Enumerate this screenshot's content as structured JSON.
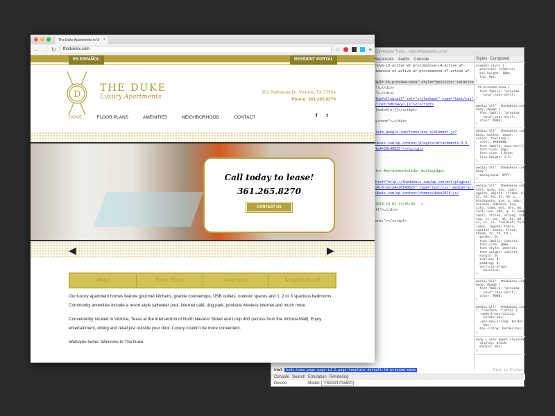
{
  "devtools": {
    "title": "Developer Tools - http://thedukeix.com/",
    "tabs": [
      "Resources",
      "Audits",
      "Console"
    ],
    "code_lines": [
      {
        "text": "nova-i3-active wf-proximanova-i4-active wf-",
        "cls": ""
      },
      {
        "text": "imanova-n4-active wf-proximanova-n7-active wf-",
        "cls": ""
      },
      {
        "text": "",
        "cls": ""
      },
      {
        "text": "ault tk-proxima-nova\" style=\"position: relative;",
        "cls": "sel"
      },
      {
        "text": "\">…</div>",
        "cls": ""
      },
      {
        "text": "\">…</div>",
        "cls": ""
      },
      {
        "text": "lowfollowtail\" rel=\"stylesheet\" type=\"text/css\">",
        "cls": "lnk"
      },
      {
        "text": "c.net/bdb2wwyu.js\"></script>",
        "cls": "lnk"
      },
      {
        "text": "}catch(e){}</script>",
        "cls": ""
      },
      {
        "text": "",
        "cls": ""
      },
      {
        "text": "y:none\">…</div>",
        "cls": ""
      },
      {
        "text": "",
        "cls": ""
      },
      {
        "text": "late.google.com/translate_a/element.js?",
        "cls": "lnk"
      },
      {
        "text": "",
        "cls": ""
      },
      {
        "text": "ukeix.com/wp-content/plugins/attachments-3.5.",
        "cls": "lnk"
      },
      {
        "text": "ta4=20140825\"></script>",
        "cls": "lnk"
      },
      {
        "text": "",
        "cls": ""
      },
      {
        "text": "",
        "cls": ""
      },
      {
        "text": "",
        "cls": ""
      },
      {
        "text": "for #attachmentslider_multiwidget",
        "cls": "cm"
      },
      {
        "text": "",
        "cls": ""
      },
      {
        "text": "href=\"http://thedukeix.com/wp-content/plugins/",
        "cls": "lnk"
      },
      {
        "text": "s4-8-beta4=20140825\" type=\"text/css\" media=\"all\">",
        "cls": "lnk"
      },
      {
        "text": "ukeix.com/wp-content/themes/duke2014/js/",
        "cls": "lnk"
      },
      {
        "text": "",
        "cls": ""
      },
      {
        "text": "2014-10-01 13:45:09 -->",
        "cls": "cm"
      },
      {
        "text": "ft\">…</div>",
        "cls": ""
      },
      {
        "text": "",
        "cls": ""
      },
      {
        "text": "one;\"></script>",
        "cls": ""
      }
    ],
    "styles_tabs": [
      "Styles",
      "Computed"
    ],
    "style_rules": [
      "element.style {\n  position: relative;\n  min-height: 100%;\n  top: 0px;\n}",
      ".tk-proxima-nova {\n  font-family: \"proxima-\n    nova\",sans-serif;\n}",
      "media=\"all\"  thedukeix.com/\nbody, #page {\n  font-family: \"proxima-\n    nova\",sans-serif;\n  color: #000;\n}",
      "media=\"all\"  thedukeix.com/\nbody, button, input,\nselect, textarea {\n  color: #404040;\n  font-family: sans-serif;\n  font-size: 16px;\n  font-size: 1.6rem;\n  line-height: 1.5;\n}",
      "media=\"all\"  thedukeix.com/\nbody {\n  background: #fff;\n}",
      "media=\"all\"  thedukeix.com/\nhtml, body, div, span,\napplet, object, iframe, h1,\nh2, h3, h4, h5, h6, p,\nblockquote, pre, a, abbr,\nacronym, address, big,\ncite, code, del, dfn, em,\nfont, ins, kbd, q, s, samp,\nsmall, strike, strong, sub,\nsup, tt, var, dl, dt, dd,\nol, ul, li, fieldset, form,\nlabel, legend, table,\ncaption, tbody, tfoot,\nthead, tr, th, td {\n  border: 0;\n  font-family: inherit;\n  font-size: 100%;\n  font-style: inherit;\n  font-weight: inherit;\n  margin: 0;\n  outline: 0;\n  padding: 0;\n  vertical-align:\n    baseline;\n}",
      "media=\"all\"  thedukeix.com/\nbody, #page {\n  font-family: \"proxima-\n    nova\",sans-serif;\n  color: #000;\n}",
      "media=\"all\"  thedukeix.com/\n*, *:before, *:after {\n  -webkit-box-sizing:\n    border-box;\n  -moz-box-sizing: border-\n    box;\n  box-sizing: border-box;\n}",
      "body { user agent stylesheet\n  display: block;\n  margin: 8px;\n}"
    ],
    "find_placeholder": "Find in Styles",
    "crumb_label": "html",
    "crumb": "body.home.page.page-id-2.page-template-default.tk-proxima-nova",
    "bottom_tabs": [
      "Console",
      "Search",
      "Emulation",
      "Rendering"
    ],
    "device_label": "Device",
    "model_label": "Model:",
    "model_value": "<Select model>"
  },
  "browser": {
    "tab_title": "The Duke Apartments in Vi",
    "url": "thedukeix.com"
  },
  "site": {
    "top_left": "EN ESPAÑOL",
    "top_right": "RESIDENT PORTAL",
    "brand_name": "THE DUKE",
    "brand_sub": "Luxury Apartments",
    "address": "301 Parkstone Dr. Victoria, TX 77904",
    "phone": "Phone: 361.265.8270",
    "nav": [
      "HOME",
      "FLOOR PLANS",
      "AMENITIES",
      "NEIGHBORHOOD",
      "CONTACT"
    ],
    "social": [
      "f",
      "t"
    ],
    "callout_line1": "Call today to lease!",
    "callout_phone": "361.265.8270",
    "callout_button": "CONTACT US",
    "subnav": [
      "About",
      "Floor Plans",
      "Amenities",
      "Neighborhood"
    ],
    "paragraphs": [
      "Our luxury apartment homes feature gourmet kitchens, granite countertops, USB outlets, outdoor spaces and 1, 2 or 3 spacious bedrooms. Community amenities include a resort-style saltwater pool, internet café, dog park, poolside wireless internet and much more.",
      "Conveniently located in Victoria, Texas at the intersection of North Navarro Street and Loop 463 (across from the Victoria Mall). Enjoy entertainment, dining and retail just outside your door. Luxury couldn't be more convenient.",
      "Welcome home. Welcome to The Duke."
    ]
  },
  "colors": {
    "gold": "#b5a23a",
    "dark_gold": "#8d7d27",
    "subnav": "#d4c352"
  }
}
